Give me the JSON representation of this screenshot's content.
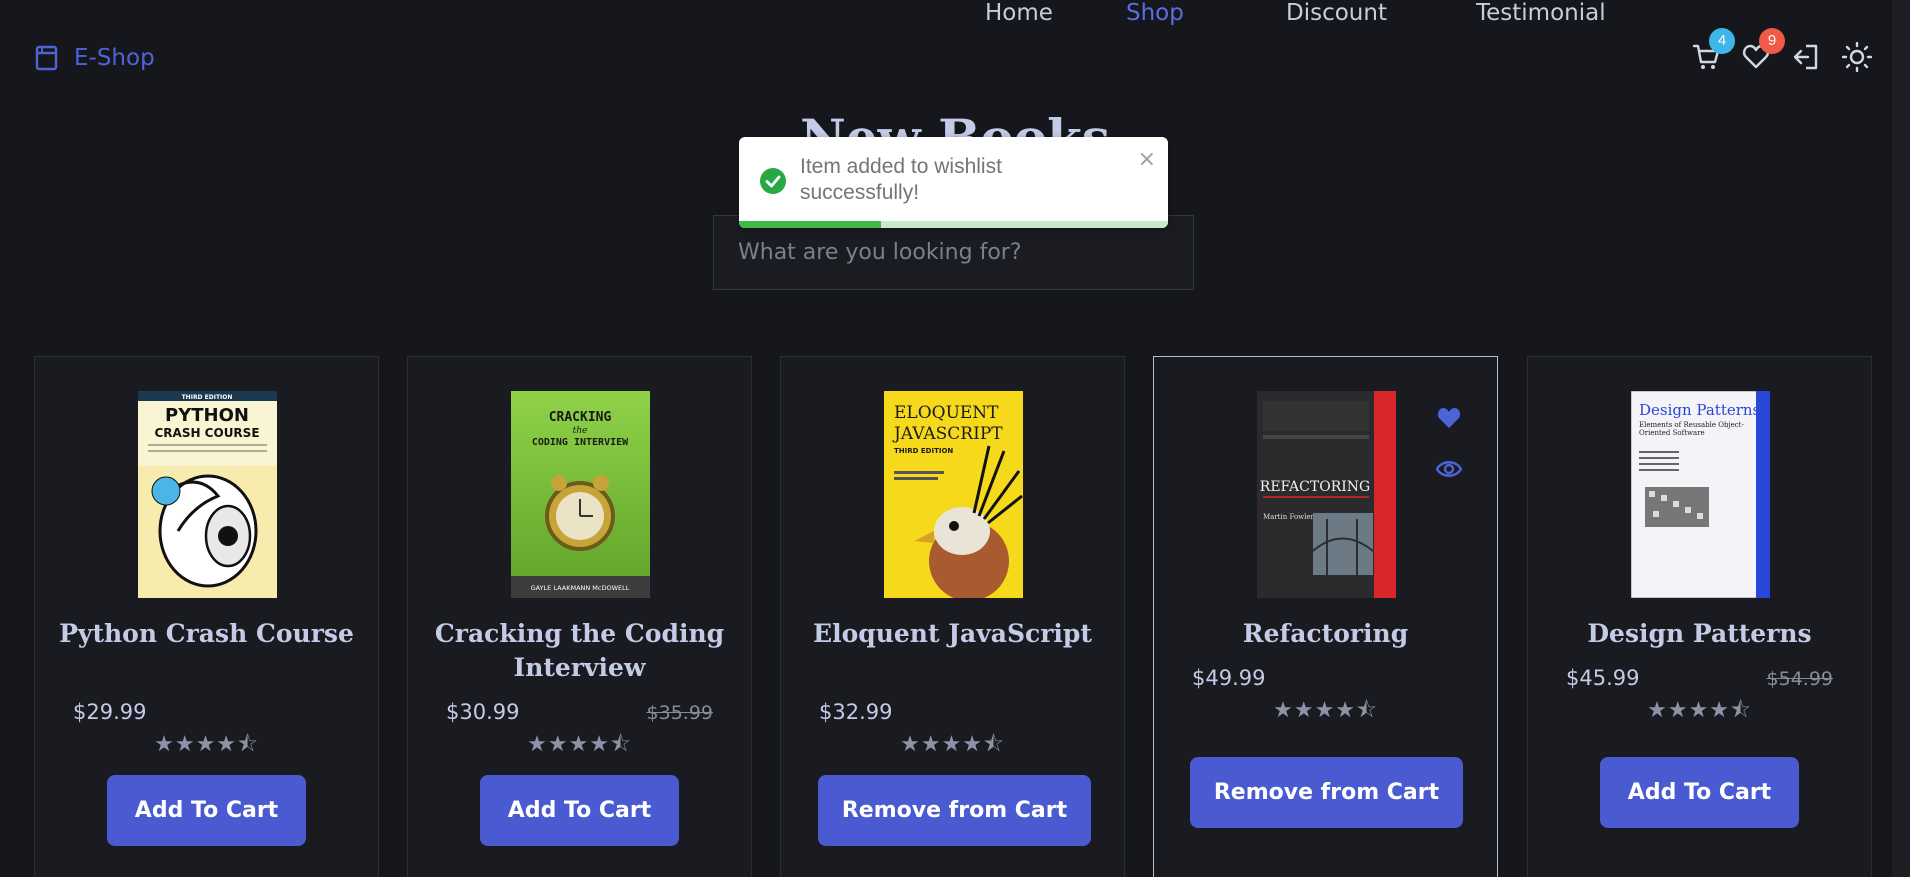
{
  "brand": {
    "name": "E-Shop"
  },
  "nav": {
    "links": [
      {
        "label": "Home",
        "active": false
      },
      {
        "label": "Shop",
        "active": true
      },
      {
        "label": "Discount",
        "active": false
      },
      {
        "label": "Testimonial",
        "active": false
      }
    ],
    "cart_count": "4",
    "wishlist_count": "9"
  },
  "section": {
    "title": "New Books"
  },
  "search": {
    "placeholder": "What are you looking for?"
  },
  "toast": {
    "message": "Item added to wishlist successfully!",
    "close_label": "×",
    "progress": 0.33
  },
  "colors": {
    "accent": "#4a5bd1",
    "background": "#16171c",
    "card": "#1a1b21",
    "toast_success": "#3fb948"
  },
  "products": [
    {
      "title": "Python Crash Course",
      "price": "$29.99",
      "old_price": "",
      "rating": 4.5,
      "stars": "★★★★⯪",
      "button": "Add To Cart",
      "cover": {
        "line1": "PYTHON",
        "line2": "CRASH COURSE",
        "top": "THIRD EDITION",
        "bg": "#f7ecae",
        "band": "#1b3a52"
      }
    },
    {
      "title": "Cracking the Coding Interview",
      "price": "$30.99",
      "old_price": "$35.99",
      "rating": 4.5,
      "stars": "★★★★⯪",
      "button": "Add To Cart",
      "cover": {
        "line1": "CRACKING",
        "line2": "the",
        "line3": "CODING INTERVIEW",
        "footer": "GAYLE LAAKMANN McDOWELL",
        "bg": "#7cc43a"
      }
    },
    {
      "title": "Eloquent JavaScript",
      "price": "$32.99",
      "old_price": "",
      "rating": 4.5,
      "stars": "★★★★⯪",
      "button": "Remove from Cart",
      "cover": {
        "line1": "ELOQUENT",
        "line2": "JAVASCRIPT",
        "edition": "THIRD EDITION",
        "bg": "#f6d91b"
      }
    },
    {
      "title": "Refactoring",
      "price": "$49.99",
      "old_price": "",
      "rating": 4.5,
      "stars": "★★★★⯪",
      "button": "Remove from Cart",
      "wishlisted": true,
      "cover": {
        "line1": "REFACTORING",
        "author": "Martin Fowler",
        "bg": "#2b2a2c",
        "stripe": "#d9262b"
      }
    },
    {
      "title": "Design Patterns",
      "price": "$45.99",
      "old_price": "$54.99",
      "rating": 4.5,
      "stars": "★★★★⯪",
      "button": "Add To Cart",
      "cover": {
        "line1": "Design Patterns",
        "line2": "Elements of Reusable Object-Oriented Software",
        "bg": "#f4f4f8",
        "stripe": "#2a46d6"
      }
    }
  ]
}
